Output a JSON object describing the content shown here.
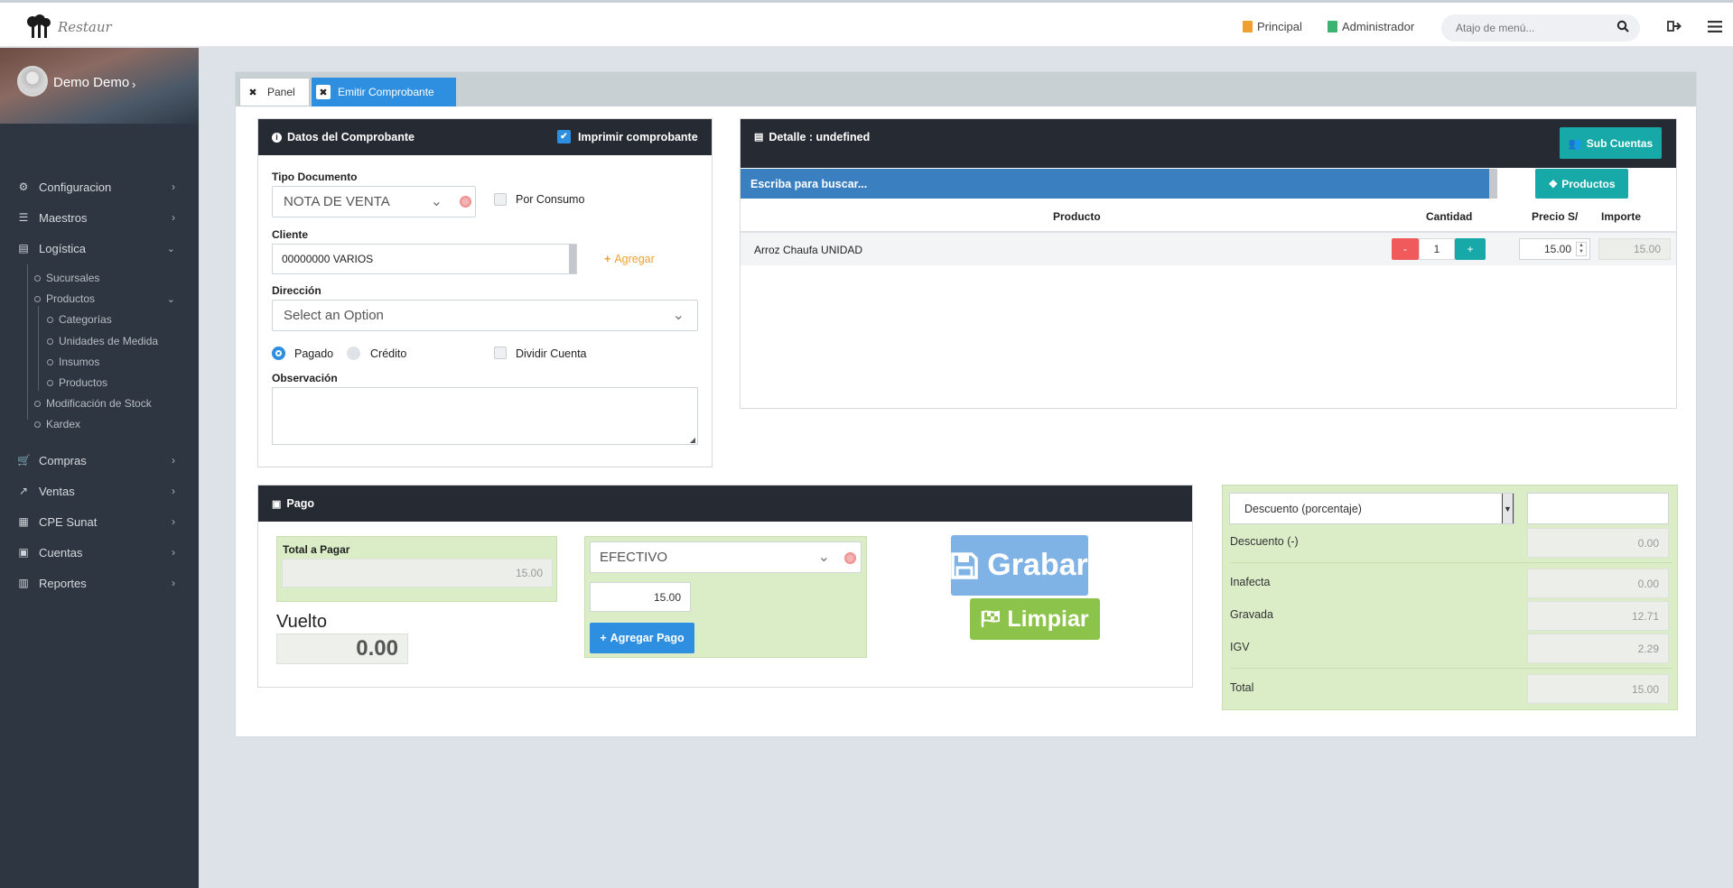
{
  "topbar": {
    "logo_text": "Restaur",
    "link_principal": "Principal",
    "link_admin": "Administrador",
    "search_placeholder": "Atajo de menú..."
  },
  "sidebar": {
    "user_name": "Demo Demo",
    "items": {
      "configuracion": "Configuracion",
      "maestros": "Maestros",
      "logistica": "Logística",
      "sucursales": "Sucursales",
      "productos": "Productos",
      "categorias": "Categorías",
      "unidades": "Unidades de Medida",
      "insumos": "Insumos",
      "productos_sub": "Productos",
      "modificacion": "Modificación de Stock",
      "kardex": "Kardex",
      "compras": "Compras",
      "ventas": "Ventas",
      "cpe": "CPE Sunat",
      "cuentas": "Cuentas",
      "reportes": "Reportes"
    }
  },
  "tabs": {
    "panel": "Panel",
    "emitir": "Emitir Comprobante"
  },
  "datos": {
    "title": "Datos del Comprobante",
    "imprimir_label": "Imprimir comprobante",
    "tipo_label": "Tipo Documento",
    "tipo_value": "NOTA DE VENTA",
    "por_consumo": "Por Consumo",
    "cliente_label": "Cliente",
    "cliente_value": "00000000 VARIOS",
    "agregar": "Agregar",
    "direccion_label": "Dirección",
    "direccion_value": "Select an Option",
    "pagado": "Pagado",
    "credito": "Crédito",
    "dividir": "Dividir Cuenta",
    "observacion_label": "Observación"
  },
  "detalle": {
    "title": "Detalle : undefined",
    "sub_cuentas": "Sub Cuentas",
    "search_placeholder": "Escriba para buscar...",
    "productos_btn": "Productos",
    "columns": {
      "producto": "Producto",
      "cantidad": "Cantidad",
      "precio": "Precio S/",
      "importe": "Importe"
    },
    "rows": [
      {
        "producto": "Arroz Chaufa UNIDAD",
        "minus": "-",
        "cantidad": "1",
        "plus": "+",
        "precio": "15.00",
        "importe": "15.00"
      }
    ]
  },
  "pago": {
    "title": "Pago",
    "total_label": "Total a Pagar",
    "total_value": "15.00",
    "vuelto_label": "Vuelto",
    "vuelto_value": "0.00",
    "metodo": "EFECTIVO",
    "monto": "15.00",
    "agregar_pago": "Agregar Pago",
    "grabar": "Grabar",
    "limpiar": "Limpiar"
  },
  "totales": {
    "descuento_tipo": "Descuento (porcentaje)",
    "descuento_label": "Descuento (-)",
    "descuento_value": "0.00",
    "inafecta_label": "Inafecta",
    "inafecta_value": "0.00",
    "gravada_label": "Gravada",
    "gravada_value": "12.71",
    "igv_label": "IGV",
    "igv_value": "2.29",
    "total_label": "Total",
    "total_value": "15.00"
  },
  "colors": {
    "sidebar": "#2e3741",
    "dark_header": "#262b33",
    "active_tab": "#2e8fe0",
    "teal": "#17a8a8",
    "green_box": "#daedc7",
    "grabar": "#7fb3e6",
    "limpiar": "#8cc34a",
    "minus": "#f05a5a",
    "search_bar": "#3a7fc0"
  }
}
